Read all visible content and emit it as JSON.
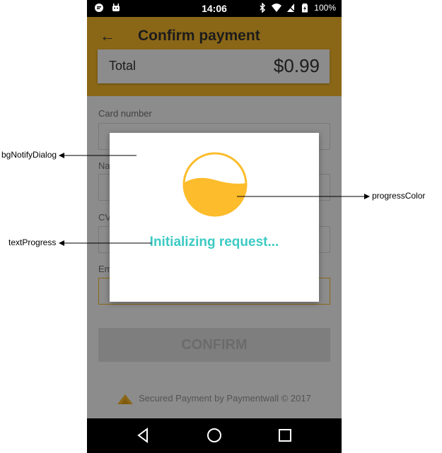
{
  "status_bar": {
    "time": "14:06",
    "battery": "100%",
    "icons": [
      "notification-icon",
      "android-icon",
      "bluetooth-icon",
      "wifi-icon",
      "no-sim-icon",
      "battery-icon"
    ]
  },
  "app_bar": {
    "back_icon": "arrow-left-icon",
    "title": "Confirm payment"
  },
  "total": {
    "label": "Total",
    "amount": "$0.99"
  },
  "form": {
    "card_number_label": "Card number",
    "card_number_value": "•••• •••• •••• ••••",
    "name_label": "Na",
    "cvv_label": "CV",
    "email_label": "Em"
  },
  "confirm_button": "CONFIRM",
  "footer": {
    "text": "Secured Payment by Paymentwall © 2017"
  },
  "dialog": {
    "progress_text": "Initializing request...",
    "progress_fill": 0.55
  },
  "annotations": {
    "bg_dialog": "bgNotifyDialog",
    "progress_color": "progressColor",
    "text_progress": "textProgress"
  },
  "colors": {
    "accent": "#fcbc2b",
    "progress_text": "#3ccac4"
  }
}
